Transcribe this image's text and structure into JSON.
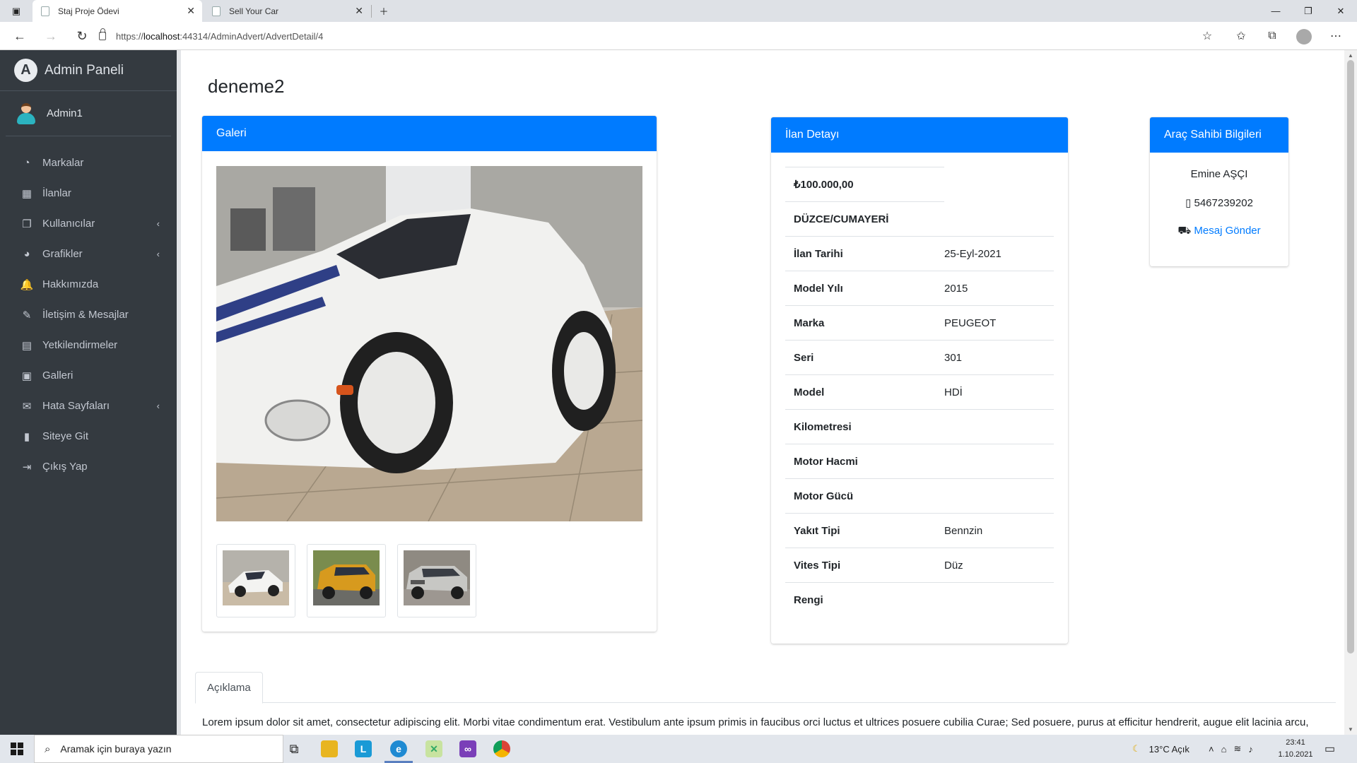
{
  "browser": {
    "tabs": [
      {
        "title": "Staj Proje Ödevi",
        "active": true
      },
      {
        "title": "Sell Your Car",
        "active": false
      }
    ],
    "url_prefix": "https://",
    "url_host": "localhost",
    "url_rest": ":44314/AdminAdvert/AdvertDetail/4"
  },
  "sidebar": {
    "brand": "Admin Paneli",
    "brand_letter": "A",
    "user": "Admin1",
    "items": [
      {
        "label": "Markalar",
        "icon": "tachometer-icon",
        "glyph": "◔",
        "submenu": false
      },
      {
        "label": "İlanlar",
        "icon": "grid-icon",
        "glyph": "▦",
        "submenu": false
      },
      {
        "label": "Kullanıcılar",
        "icon": "copy-icon",
        "glyph": "❐",
        "submenu": true
      },
      {
        "label": "Grafikler",
        "icon": "pie-chart-icon",
        "glyph": "◕",
        "submenu": true
      },
      {
        "label": "Hakkımızda",
        "icon": "bell-icon",
        "glyph": "🔔",
        "submenu": false
      },
      {
        "label": "İletişim & Mesajlar",
        "icon": "edit-icon",
        "glyph": "✎",
        "submenu": false
      },
      {
        "label": "Yetkilendirmeler",
        "icon": "calendar-icon",
        "glyph": "▤",
        "submenu": false
      },
      {
        "label": "Galleri",
        "icon": "image-icon",
        "glyph": "▣",
        "submenu": false
      },
      {
        "label": "Hata Sayfaları",
        "icon": "envelope-icon",
        "glyph": "✉",
        "submenu": true
      },
      {
        "label": "Siteye Git",
        "icon": "book-icon",
        "glyph": "▮",
        "submenu": false
      },
      {
        "label": "Çıkış Yap",
        "icon": "sign-out-icon",
        "glyph": "⇥",
        "submenu": false
      }
    ]
  },
  "page": {
    "title": "deneme2"
  },
  "gallery": {
    "header": "Galeri",
    "thumb_count": 3
  },
  "detail": {
    "header": "İlan Detayı",
    "price": "₺100.000,00",
    "location": "DÜZCE/CUMAYERİ",
    "rows": [
      {
        "key": "İlan Tarihi",
        "value": "25-Eyl-2021"
      },
      {
        "key": "Model Yılı",
        "value": "2015"
      },
      {
        "key": "Marka",
        "value": "PEUGEOT"
      },
      {
        "key": "Seri",
        "value": "301"
      },
      {
        "key": "Model",
        "value": "HDİ"
      },
      {
        "key": "Kilometresi",
        "value": ""
      },
      {
        "key": "Motor Hacmi",
        "value": ""
      },
      {
        "key": "Motor Gücü",
        "value": ""
      },
      {
        "key": "Yakıt Tipi",
        "value": "Bennzin"
      },
      {
        "key": "Vites Tipi",
        "value": "Düz"
      },
      {
        "key": "Rengi",
        "value": ""
      }
    ]
  },
  "owner": {
    "header": "Araç Sahibi Bilgileri",
    "name": "Emine AŞÇI",
    "phone": "5467239202",
    "message_link": "Mesaj Gönder"
  },
  "description": {
    "tab": "Açıklama",
    "text": "Lorem ipsum dolor sit amet, consectetur adipiscing elit. Morbi vitae condimentum erat. Vestibulum ante ipsum primis in faucibus orci luctus et ultrices posuere cubilia Curae; Sed posuere, purus at efficitur hendrerit, augue elit lacinia arcu,"
  },
  "taskbar": {
    "search_placeholder": "Aramak için buraya yazın",
    "weather": "13°C  Açık",
    "time": "23:41",
    "date": "1.10.2021"
  },
  "colors": {
    "accent": "#007bff",
    "sidebar_bg": "#343a40"
  }
}
